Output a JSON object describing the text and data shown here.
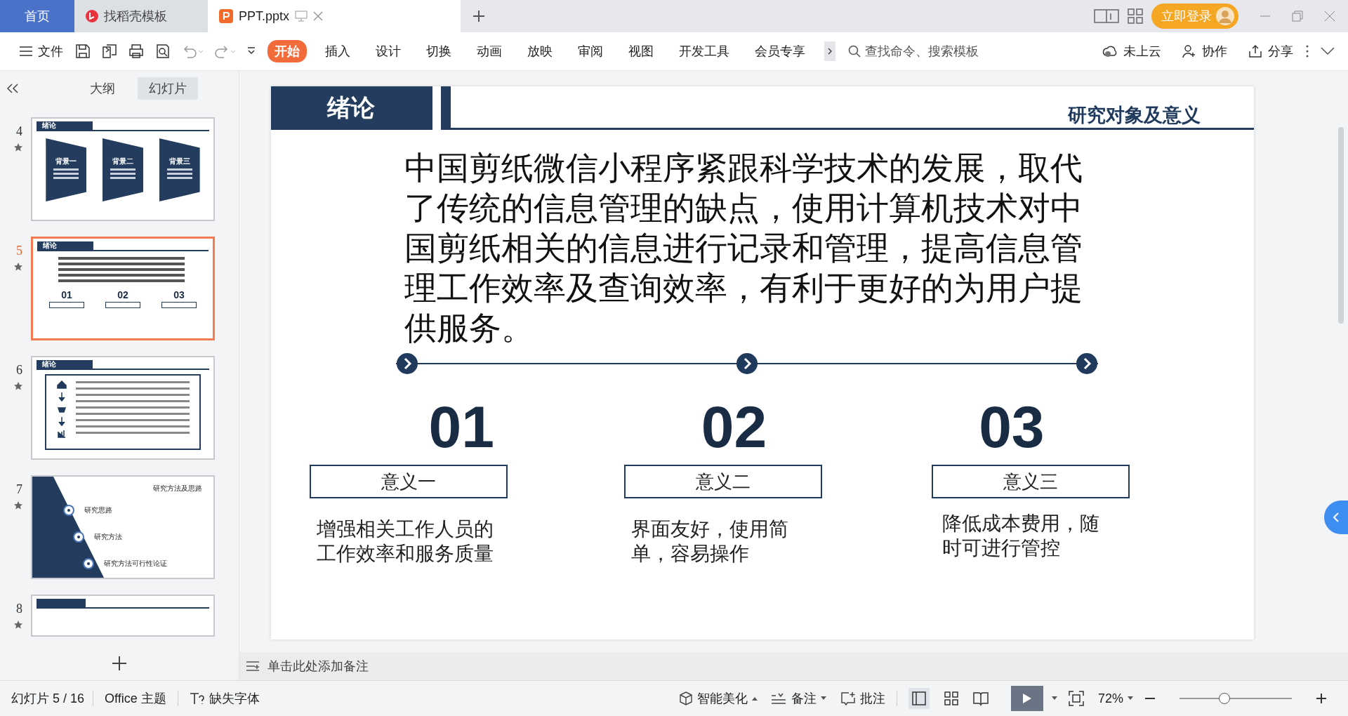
{
  "tabs": [
    {
      "label": "首页",
      "kind": "home",
      "selected": false
    },
    {
      "label": "找稻壳模板",
      "kind": "docer",
      "selected": false
    },
    {
      "label": "PPT.pptx",
      "kind": "file",
      "selected": true
    }
  ],
  "login_button": "立即登录",
  "file_menu": "文件",
  "ribbon_tabs": [
    {
      "label": "开始",
      "selected": true
    },
    {
      "label": "插入",
      "selected": false
    },
    {
      "label": "设计",
      "selected": false
    },
    {
      "label": "切换",
      "selected": false
    },
    {
      "label": "动画",
      "selected": false
    },
    {
      "label": "放映",
      "selected": false
    },
    {
      "label": "审阅",
      "selected": false
    },
    {
      "label": "视图",
      "selected": false
    },
    {
      "label": "开发工具",
      "selected": false
    },
    {
      "label": "会员专享",
      "selected": false
    }
  ],
  "search": {
    "placeholder": "查找命令、搜索模板"
  },
  "actions": [
    {
      "label": "未上云",
      "kind": "cloud"
    },
    {
      "label": "协作",
      "kind": "share-user"
    },
    {
      "label": "分享",
      "kind": "share"
    }
  ],
  "panel_tabs": [
    {
      "label": "大纲",
      "selected": false
    },
    {
      "label": "幻灯片",
      "selected": true
    }
  ],
  "thumbnails": [
    {
      "number": "4",
      "kind": "background",
      "selected": false,
      "header": "绪论",
      "items": [
        "背景一",
        "背景二",
        "背景三"
      ]
    },
    {
      "number": "5",
      "kind": "current",
      "selected": true,
      "header": "绪论",
      "items": [
        "01",
        "02",
        "03"
      ]
    },
    {
      "number": "6",
      "kind": "list",
      "selected": false,
      "header": "绪论"
    },
    {
      "number": "7",
      "kind": "method",
      "selected": false,
      "header": "研究方法及思路",
      "items": [
        "研究思路",
        "研究方法",
        "研究方法可行性论证"
      ]
    },
    {
      "number": "8",
      "kind": "partial",
      "selected": false
    }
  ],
  "slide": {
    "header": "绪论",
    "subtitle": "研究对象及意义",
    "body": "中国剪纸微信小程序紧跟科学技术的发展，取代了传统的信息管理的缺点，使用计算机技术对中国剪纸相关的信息进行记录和管理，提高信息管理工作效率及查询效率，有利于更好的为用户提供服务。",
    "points": [
      {
        "number": "01",
        "label": "意义一",
        "text": "增强相关工作人员的工作效率和服务质量"
      },
      {
        "number": "02",
        "label": "意义二",
        "text": "界面友好，使用简单，容易操作"
      },
      {
        "number": "03",
        "label": "意义三",
        "text": "降低成本费用，随时可进行管控"
      }
    ]
  },
  "notes": {
    "placeholder": "单击此处添加备注"
  },
  "status": {
    "slide_count": "幻灯片 5 / 16",
    "theme": "Office 主题",
    "missing_font": "缺失字体",
    "beautify": "智能美化",
    "notes": "备注",
    "comments": "批注",
    "zoom": "72%",
    "level": 0.4
  }
}
